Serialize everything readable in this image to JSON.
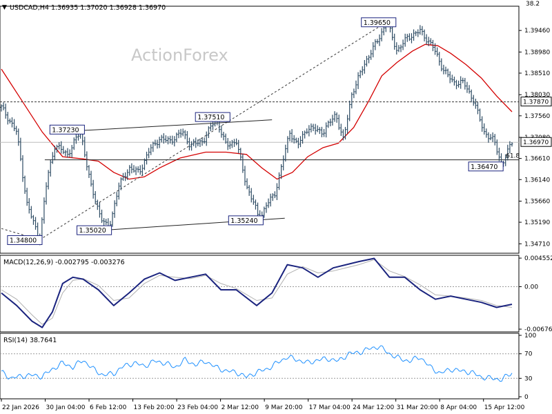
{
  "colors": {
    "bars": "#2d4b63",
    "ma": "#d40000",
    "macd_line": "#1a237e",
    "signal_line": "#b0b0b0",
    "rsi": "#1e90ff",
    "ref_line": "#222222",
    "dashed": "#333333"
  },
  "header": {
    "arrow": "▼",
    "text": "USDCAD,H4  1.36935 1.37020 1.36928 1.36970"
  },
  "watermark": "ActionForex",
  "chart_data": [
    {
      "type": "ohlc",
      "title": "USDCAD,H4",
      "last_ohlc": {
        "open": 1.36935,
        "high": 1.3702,
        "low": 1.36928,
        "close": 1.3697
      },
      "ylim": [
        1.345,
        1.4
      ],
      "y_ticks": [
        "1.39460",
        "1.38980",
        "1.38510",
        "1.38030",
        "1.37560",
        "1.37080",
        "1.36610",
        "1.36140",
        "1.35660",
        "1.35190",
        "1.34710"
      ],
      "top_tick": "38.2",
      "last_price_label": "1.36970",
      "hline_label": "1.37870",
      "fib_label": "61.8",
      "annotations": [
        "1.34800",
        "1.35020",
        "1.37230",
        "1.37510",
        "1.35240",
        "1.39650",
        "1.36470"
      ],
      "ma_overlay": "red moving average line",
      "price_path": [
        [
          0,
          1.3775
        ],
        [
          0.03,
          1.372
        ],
        [
          0.05,
          1.356
        ],
        [
          0.075,
          1.348
        ],
        [
          0.09,
          1.362
        ],
        [
          0.105,
          1.369
        ],
        [
          0.13,
          1.367
        ],
        [
          0.155,
          1.3723
        ],
        [
          0.175,
          1.36
        ],
        [
          0.195,
          1.353
        ],
        [
          0.21,
          1.3502
        ],
        [
          0.23,
          1.36
        ],
        [
          0.25,
          1.364
        ],
        [
          0.27,
          1.363
        ],
        [
          0.29,
          1.368
        ],
        [
          0.31,
          1.3705
        ],
        [
          0.33,
          1.37
        ],
        [
          0.355,
          1.372
        ],
        [
          0.37,
          1.369
        ],
        [
          0.395,
          1.37
        ],
        [
          0.42,
          1.3751
        ],
        [
          0.44,
          1.369
        ],
        [
          0.46,
          1.37
        ],
        [
          0.48,
          1.36
        ],
        [
          0.495,
          1.356
        ],
        [
          0.505,
          1.3524
        ],
        [
          0.52,
          1.356
        ],
        [
          0.535,
          1.358
        ],
        [
          0.55,
          1.365
        ],
        [
          0.565,
          1.372
        ],
        [
          0.58,
          1.369
        ],
        [
          0.6,
          1.373
        ],
        [
          0.63,
          1.372
        ],
        [
          0.655,
          1.376
        ],
        [
          0.67,
          1.37
        ],
        [
          0.685,
          1.38
        ],
        [
          0.71,
          1.387
        ],
        [
          0.735,
          1.392
        ],
        [
          0.755,
          1.3965
        ],
        [
          0.775,
          1.39
        ],
        [
          0.795,
          1.393
        ],
        [
          0.82,
          1.3945
        ],
        [
          0.845,
          1.391
        ],
        [
          0.865,
          1.386
        ],
        [
          0.885,
          1.383
        ],
        [
          0.905,
          1.383
        ],
        [
          0.925,
          1.379
        ],
        [
          0.945,
          1.372
        ],
        [
          0.965,
          1.37
        ],
        [
          0.98,
          1.3647
        ],
        [
          1.0,
          1.3697
        ]
      ],
      "ma_path": [
        [
          0,
          1.386
        ],
        [
          0.04,
          1.379
        ],
        [
          0.08,
          1.372
        ],
        [
          0.12,
          1.3665
        ],
        [
          0.16,
          1.366
        ],
        [
          0.19,
          1.3655
        ],
        [
          0.22,
          1.363
        ],
        [
          0.25,
          1.3615
        ],
        [
          0.28,
          1.362
        ],
        [
          0.31,
          1.364
        ],
        [
          0.35,
          1.3662
        ],
        [
          0.4,
          1.3675
        ],
        [
          0.44,
          1.3675
        ],
        [
          0.48,
          1.367
        ],
        [
          0.51,
          1.364
        ],
        [
          0.54,
          1.3615
        ],
        [
          0.57,
          1.363
        ],
        [
          0.6,
          1.3665
        ],
        [
          0.63,
          1.3685
        ],
        [
          0.66,
          1.3695
        ],
        [
          0.69,
          1.373
        ],
        [
          0.72,
          1.379
        ],
        [
          0.745,
          1.3845
        ],
        [
          0.775,
          1.3875
        ],
        [
          0.805,
          1.39
        ],
        [
          0.83,
          1.3915
        ],
        [
          0.855,
          1.3912
        ],
        [
          0.88,
          1.3895
        ],
        [
          0.91,
          1.387
        ],
        [
          0.94,
          1.384
        ],
        [
          0.97,
          1.38
        ],
        [
          1.0,
          1.3765
        ]
      ]
    },
    {
      "type": "line",
      "title": "MACD(12,26,9) -0.002795 -0.003276",
      "ylim": [
        -0.0072,
        0.005
      ],
      "y_ticks": [
        "0.004552",
        "0.00",
        "-0.006764"
      ],
      "series": [
        {
          "name": "MACD",
          "points": [
            [
              0,
              -0.001
            ],
            [
              0.03,
              -0.003
            ],
            [
              0.06,
              -0.0055
            ],
            [
              0.08,
              -0.0065
            ],
            [
              0.1,
              -0.004
            ],
            [
              0.12,
              0.0005
            ],
            [
              0.14,
              0.0015
            ],
            [
              0.16,
              0.0012
            ],
            [
              0.19,
              -0.0005
            ],
            [
              0.22,
              -0.003
            ],
            [
              0.25,
              -0.001
            ],
            [
              0.28,
              0.0012
            ],
            [
              0.31,
              0.0022
            ],
            [
              0.34,
              0.001
            ],
            [
              0.37,
              0.0015
            ],
            [
              0.4,
              0.002
            ],
            [
              0.43,
              -0.0005
            ],
            [
              0.46,
              -0.0005
            ],
            [
              0.5,
              -0.003
            ],
            [
              0.53,
              -0.001
            ],
            [
              0.56,
              0.0035
            ],
            [
              0.59,
              0.003
            ],
            [
              0.62,
              0.0015
            ],
            [
              0.65,
              0.003
            ],
            [
              0.7,
              0.004
            ],
            [
              0.73,
              0.0045
            ],
            [
              0.76,
              0.0015
            ],
            [
              0.79,
              0.0015
            ],
            [
              0.82,
              -0.0005
            ],
            [
              0.85,
              -0.002
            ],
            [
              0.88,
              -0.0015
            ],
            [
              0.91,
              -0.002
            ],
            [
              0.94,
              -0.0025
            ],
            [
              0.97,
              -0.0033
            ],
            [
              1.0,
              -0.0028
            ]
          ]
        },
        {
          "name": "Signal",
          "points": [
            [
              0,
              -0.0005
            ],
            [
              0.03,
              -0.002
            ],
            [
              0.06,
              -0.0045
            ],
            [
              0.08,
              -0.006
            ],
            [
              0.1,
              -0.005
            ],
            [
              0.12,
              -0.001
            ],
            [
              0.14,
              0.001
            ],
            [
              0.16,
              0.0013
            ],
            [
              0.19,
              0.0002
            ],
            [
              0.22,
              -0.0022
            ],
            [
              0.25,
              -0.0018
            ],
            [
              0.28,
              0.0005
            ],
            [
              0.31,
              0.0018
            ],
            [
              0.34,
              0.0015
            ],
            [
              0.37,
              0.0013
            ],
            [
              0.4,
              0.0018
            ],
            [
              0.43,
              0.0005
            ],
            [
              0.46,
              -0.0003
            ],
            [
              0.5,
              -0.0022
            ],
            [
              0.53,
              -0.0018
            ],
            [
              0.56,
              0.002
            ],
            [
              0.59,
              0.0032
            ],
            [
              0.62,
              0.0022
            ],
            [
              0.65,
              0.0025
            ],
            [
              0.7,
              0.0035
            ],
            [
              0.73,
              0.0043
            ],
            [
              0.76,
              0.0025
            ],
            [
              0.79,
              0.0016
            ],
            [
              0.82,
              0.0003
            ],
            [
              0.85,
              -0.0013
            ],
            [
              0.88,
              -0.0015
            ],
            [
              0.91,
              -0.0018
            ],
            [
              0.94,
              -0.0022
            ],
            [
              0.97,
              -0.003
            ],
            [
              1.0,
              -0.0033
            ]
          ]
        }
      ]
    },
    {
      "type": "line",
      "title": "RSI(14) 38.7641",
      "ylim": [
        0,
        100
      ],
      "y_ticks": [
        "100",
        "70",
        "30",
        "0"
      ],
      "levels": [
        70,
        30
      ],
      "series": [
        {
          "name": "RSI",
          "points": [
            [
              0,
              40
            ],
            [
              0.02,
              30
            ],
            [
              0.04,
              34
            ],
            [
              0.06,
              35
            ],
            [
              0.08,
              33
            ],
            [
              0.1,
              45
            ],
            [
              0.12,
              55
            ],
            [
              0.14,
              48
            ],
            [
              0.16,
              60
            ],
            [
              0.18,
              45
            ],
            [
              0.2,
              35
            ],
            [
              0.22,
              38
            ],
            [
              0.24,
              50
            ],
            [
              0.26,
              55
            ],
            [
              0.28,
              50
            ],
            [
              0.3,
              58
            ],
            [
              0.32,
              55
            ],
            [
              0.34,
              48
            ],
            [
              0.36,
              60
            ],
            [
              0.38,
              52
            ],
            [
              0.4,
              58
            ],
            [
              0.42,
              48
            ],
            [
              0.44,
              42
            ],
            [
              0.46,
              40
            ],
            [
              0.48,
              32
            ],
            [
              0.5,
              40
            ],
            [
              0.52,
              45
            ],
            [
              0.54,
              55
            ],
            [
              0.56,
              65
            ],
            [
              0.58,
              60
            ],
            [
              0.6,
              55
            ],
            [
              0.62,
              60
            ],
            [
              0.64,
              62
            ],
            [
              0.66,
              58
            ],
            [
              0.68,
              70
            ],
            [
              0.7,
              72
            ],
            [
              0.72,
              78
            ],
            [
              0.74,
              82
            ],
            [
              0.76,
              70
            ],
            [
              0.78,
              62
            ],
            [
              0.8,
              58
            ],
            [
              0.82,
              65
            ],
            [
              0.84,
              48
            ],
            [
              0.86,
              38
            ],
            [
              0.88,
              45
            ],
            [
              0.9,
              42
            ],
            [
              0.92,
              40
            ],
            [
              0.94,
              32
            ],
            [
              0.96,
              30
            ],
            [
              0.98,
              28
            ],
            [
              1.0,
              39
            ]
          ]
        }
      ]
    }
  ],
  "x_axis": {
    "labels": [
      "22 Jan 2026",
      "30 Jan 04:00",
      "6 Feb 12:00",
      "13 Feb 20:00",
      "23 Feb 04:00",
      "2 Mar 12:00",
      "9 Mar 20:00",
      "17 Mar 04:00",
      "24 Mar 12:00",
      "31 Mar 20:00",
      "8 Apr 04:00",
      "15 Apr 12:00"
    ]
  }
}
